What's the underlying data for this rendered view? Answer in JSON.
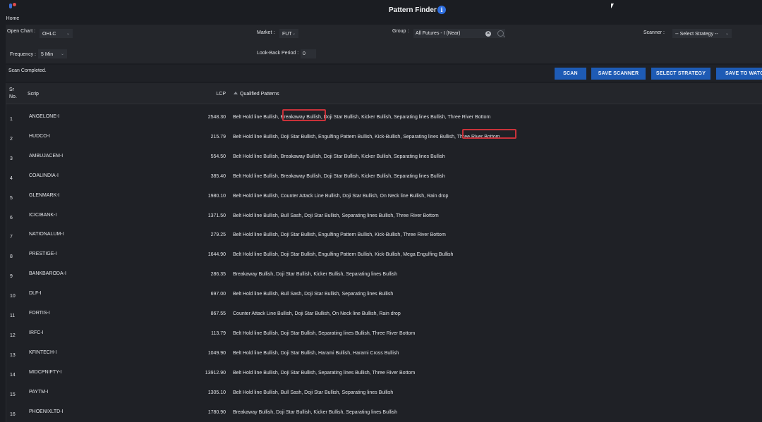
{
  "header": {
    "home_label": "Home",
    "title": "Pattern Finder",
    "info_icon": "i"
  },
  "filters": {
    "open_chart_label": "Open Chart :",
    "open_chart_value": "OHLC",
    "market_label": "Market :",
    "market_value": "FUT",
    "group_label": "Group :",
    "group_value": "All Futures - I (Near)",
    "scanner_label": "Scanner :",
    "scanner_value": "-- Select Strategy --",
    "frequency_label": "Frequency :",
    "frequency_value": "5 Min",
    "lookback_label": "Look-Back Period :",
    "lookback_value": "0"
  },
  "status": "Scan Completed.",
  "buttons": {
    "scan": "SCAN",
    "save_scanner": "SAVE SCANNER",
    "select_strategy": "SELECT STRATEGY",
    "save_to_watch": "SAVE TO WATCH"
  },
  "table": {
    "headers": {
      "sr_line1": "Sr",
      "sr_line2": "No.",
      "scrip": "Scrip",
      "lcp": "LCP",
      "patterns": "Qualified Patterns"
    },
    "rows": [
      {
        "sr": "1",
        "scrip": "ANGELONE-I",
        "lcp": "2548.30",
        "patterns": "Belt Hold line Bullish, Breakaway Bullish, Doji Star Bullish, Kicker Bullish, Separating lines Bullish, Three River Bottom"
      },
      {
        "sr": "2",
        "scrip": "HUDCO-I",
        "lcp": "215.79",
        "patterns": "Belt Hold line Bullish, Doji Star Bullish, Engulfing Pattern Bullish, Kick-Bullish, Separating lines Bullish, Three River Bottom"
      },
      {
        "sr": "3",
        "scrip": "AMBUJACEM-I",
        "lcp": "554.50",
        "patterns": "Belt Hold line Bullish, Breakaway Bullish, Doji Star Bullish, Kicker Bullish, Separating lines Bullish"
      },
      {
        "sr": "4",
        "scrip": "COALINDIA-I",
        "lcp": "385.40",
        "patterns": "Belt Hold line Bullish, Breakaway Bullish, Doji Star Bullish, Kicker Bullish, Separating lines Bullish"
      },
      {
        "sr": "5",
        "scrip": "GLENMARK-I",
        "lcp": "1980.10",
        "patterns": "Belt Hold line Bullish, Counter Attack Line Bullish, Doji Star Bullish, On Neck line Bullish, Rain drop"
      },
      {
        "sr": "6",
        "scrip": "ICICIBANK-I",
        "lcp": "1371.50",
        "patterns": "Belt Hold line Bullish, Bull Sash, Doji Star Bullish, Separating lines Bullish, Three River Bottom"
      },
      {
        "sr": "7",
        "scrip": "NATIONALUM-I",
        "lcp": "279.25",
        "patterns": "Belt Hold line Bullish, Doji Star Bullish, Engulfing Pattern Bullish, Kick-Bullish, Three River Bottom"
      },
      {
        "sr": "8",
        "scrip": "PRESTIGE-I",
        "lcp": "1644.90",
        "patterns": "Belt Hold line Bullish, Doji Star Bullish, Engulfing Pattern Bullish, Kick-Bullish, Mega Engulfing Bullish"
      },
      {
        "sr": "9",
        "scrip": "BANKBARODA-I",
        "lcp": "286.35",
        "patterns": "Breakaway Bullish, Doji Star Bullish, Kicker Bullish, Separating lines Bullish"
      },
      {
        "sr": "10",
        "scrip": "DLF-I",
        "lcp": "697.00",
        "patterns": "Belt Hold line Bullish, Bull Sash, Doji Star Bullish, Separating lines Bullish"
      },
      {
        "sr": "11",
        "scrip": "FORTIS-I",
        "lcp": "867.55",
        "patterns": "Counter Attack Line Bullish, Doji Star Bullish, On Neck line Bullish, Rain drop"
      },
      {
        "sr": "12",
        "scrip": "IRFC-I",
        "lcp": "113.79",
        "patterns": "Belt Hold line Bullish, Doji Star Bullish, Separating lines Bullish, Three River Bottom"
      },
      {
        "sr": "13",
        "scrip": "KFINTECH-I",
        "lcp": "1049.90",
        "patterns": "Belt Hold line Bullish, Doji Star Bullish, Harami Bullish, Harami Cross Bullish"
      },
      {
        "sr": "14",
        "scrip": "MIDCPNIFTY-I",
        "lcp": "13912.90",
        "patterns": "Belt Hold line Bullish, Doji Star Bullish, Separating lines Bullish, Three River Bottom"
      },
      {
        "sr": "15",
        "scrip": "PAYTM-I",
        "lcp": "1305.10",
        "patterns": "Belt Hold line Bullish, Bull Sash, Doji Star Bullish, Separating lines Bullish"
      },
      {
        "sr": "16",
        "scrip": "PHOENIXLTD-I",
        "lcp": "1780.90",
        "patterns": "Breakaway Bullish, Doji Star Bullish, Kicker Bullish, Separating lines Bullish"
      }
    ]
  },
  "colors": {
    "accent": "#1e5bb5",
    "highlight": "#c9323a",
    "background": "#1b1d22"
  }
}
